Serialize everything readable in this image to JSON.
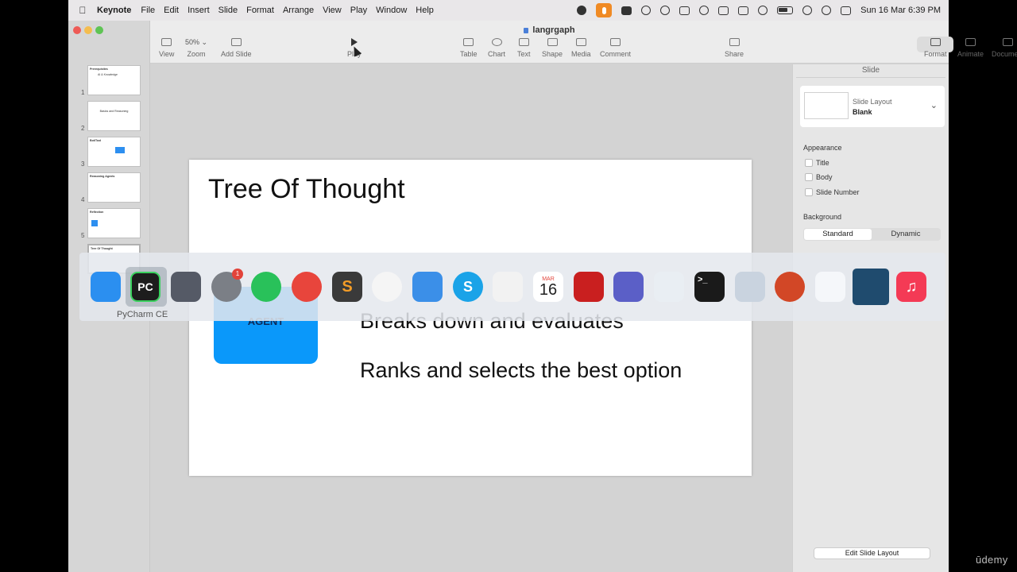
{
  "menubar": {
    "app_name": "Keynote",
    "menus": [
      "File",
      "Edit",
      "Insert",
      "Slide",
      "Format",
      "Arrange",
      "View",
      "Play",
      "Window",
      "Help"
    ],
    "datetime": "Sun 16 Mar  6:39 PM"
  },
  "window": {
    "title": "langrgaph",
    "toolbar": {
      "view": "View",
      "zoom_value": "50% ⌄",
      "zoom": "Zoom",
      "add_slide": "Add Slide",
      "play": "Play",
      "table": "Table",
      "chart": "Chart",
      "text": "Text",
      "shape": "Shape",
      "media": "Media",
      "comment": "Comment",
      "share": "Share",
      "format": "Format",
      "animate": "Animate",
      "document": "Document"
    }
  },
  "navigator": {
    "slides": [
      {
        "number": "1",
        "title": "Prerequisites",
        "body": "AI & Knowledge"
      },
      {
        "number": "2",
        "title": "",
        "body": "Basics and Reasoning"
      },
      {
        "number": "3",
        "title": "Bot/Tool",
        "body": ""
      },
      {
        "number": "4",
        "title": "Reasoning Agents",
        "body": ""
      },
      {
        "number": "5",
        "title": "Reflection",
        "body": ""
      },
      {
        "number": "6",
        "title": "Tree Of Thought",
        "body": ""
      }
    ]
  },
  "slide": {
    "title": "Tree Of Thought",
    "agent_label": "AGENT",
    "bullets": [
      "Breaks down and evaluates",
      "Ranks and selects the best option"
    ]
  },
  "inspector": {
    "tab": "Slide",
    "layout_label": "Slide Layout",
    "layout_value": "Blank",
    "appearance_heading": "Appearance",
    "appearance_options": [
      "Title",
      "Body",
      "Slide Number"
    ],
    "background_heading": "Background",
    "background_options": [
      "Standard",
      "Dynamic"
    ],
    "edit_layout_button": "Edit Slide Layout"
  },
  "dock": {
    "hovered_label": "PyCharm CE",
    "pycharm_text": "PC",
    "settings_badge": "1",
    "calendar_month": "MAR",
    "calendar_day": "16",
    "terminal_prompt": ">_",
    "apps": [
      {
        "name": "Keynote",
        "icon": "keynote-icon",
        "color": "#2b8ff0"
      },
      {
        "name": "PyCharm CE",
        "icon": "pycharm-icon",
        "color": "#1d1d1d"
      },
      {
        "name": "Launchpad",
        "icon": "launchpad-icon",
        "color": "#555a66"
      },
      {
        "name": "System Settings",
        "icon": "settings-icon",
        "color": "#7b7f86"
      },
      {
        "name": "WhatsApp",
        "icon": "whatsapp-icon",
        "color": "#29c15a"
      },
      {
        "name": "Chrome",
        "icon": "chrome-icon",
        "color": "#e8453c"
      },
      {
        "name": "Sublime Text",
        "icon": "sublime-icon",
        "color": "#3a3a3a"
      },
      {
        "name": "ChatGPT",
        "icon": "chatgpt-icon",
        "color": "#f5f5f5"
      },
      {
        "name": "Finder",
        "icon": "finder-icon",
        "color": "#3b8fe8"
      },
      {
        "name": "Skype",
        "icon": "skype-icon",
        "color": "#1aa3e8"
      },
      {
        "name": "TextEdit",
        "icon": "textedit-icon",
        "color": "#f2f2f2"
      },
      {
        "name": "Calendar",
        "icon": "calendar-icon",
        "color": "#ffffff"
      },
      {
        "name": "Acrobat",
        "icon": "acrobat-icon",
        "color": "#c91f1f"
      },
      {
        "name": "Teams",
        "icon": "teams-icon",
        "color": "#5b5fc7"
      },
      {
        "name": "pgAdmin",
        "icon": "postgres-icon",
        "color": "#e9eef3"
      },
      {
        "name": "Terminal",
        "icon": "terminal-icon",
        "color": "#1a1a1a"
      },
      {
        "name": "Preview",
        "icon": "preview-icon",
        "color": "#c9d3df"
      },
      {
        "name": "PowerPoint",
        "icon": "powerpoint-icon",
        "color": "#d24726"
      },
      {
        "name": "VS Code",
        "icon": "vscode-icon",
        "color": "#f5f7fa"
      },
      {
        "name": "MySQL Workbench",
        "icon": "mysql-icon",
        "color": "#1f4b6e"
      },
      {
        "name": "Music",
        "icon": "music-icon",
        "color": "#f43a55"
      }
    ]
  },
  "watermark": "ūdemy"
}
